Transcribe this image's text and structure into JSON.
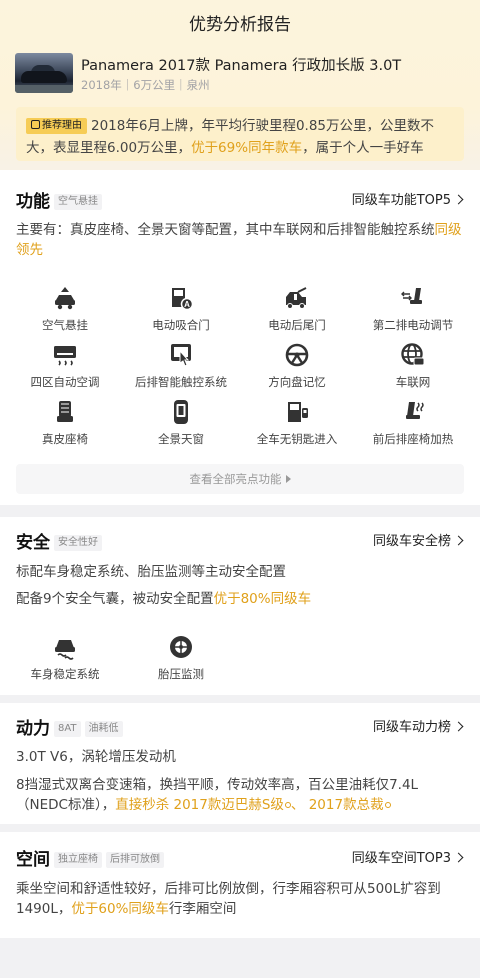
{
  "header": {
    "title": "优势分析报告"
  },
  "car": {
    "name": "Panamera 2017款 Panamera 行政加长版 3.0T",
    "meta": "2018年｜6万公里｜泉州"
  },
  "recommend": {
    "badge": "推荐理由",
    "text_before": "2018年6月上牌，年平均行驶里程0.85万公里，公里数不大，表显里程6.00万公里，",
    "text_highlight": "优于69%同年款车",
    "text_after": "，属于个人一手好车"
  },
  "function": {
    "title": "功能",
    "tag": "空气悬挂",
    "link": "同级车功能TOP5",
    "desc_before": "主要有：真皮座椅、全景天窗等配置，其中车联网和后排智能触控系统",
    "desc_highlight": "同级领先",
    "features": [
      {
        "label": "空气悬挂",
        "icon": "air-suspension-icon"
      },
      {
        "label": "电动吸合门",
        "icon": "soft-close-door-icon"
      },
      {
        "label": "电动后尾门",
        "icon": "power-tailgate-icon"
      },
      {
        "label": "第二排电动调节",
        "icon": "second-row-seat-icon"
      },
      {
        "label": "四区自动空调",
        "icon": "climate-icon"
      },
      {
        "label": "后排智能触控系统",
        "icon": "touch-control-icon"
      },
      {
        "label": "方向盘记忆",
        "icon": "steering-wheel-icon"
      },
      {
        "label": "车联网",
        "icon": "globe-icon"
      },
      {
        "label": "真皮座椅",
        "icon": "leather-seat-icon"
      },
      {
        "label": "全景天窗",
        "icon": "sunroof-icon"
      },
      {
        "label": "全车无钥匙进入",
        "icon": "keyless-door-icon"
      },
      {
        "label": "前后排座椅加热",
        "icon": "heated-seat-icon"
      }
    ],
    "more": "查看全部亮点功能"
  },
  "safety": {
    "title": "安全",
    "tag": "安全性好",
    "link": "同级车安全榜",
    "line1": "标配车身稳定系统、胎压监测等主动安全配置",
    "line2_before": "配备9个安全气囊，被动安全配置",
    "line2_highlight": "优于80%同级车",
    "features": [
      {
        "label": "车身稳定系统",
        "icon": "stability-icon"
      },
      {
        "label": "胎压监测",
        "icon": "tire-pressure-icon"
      }
    ]
  },
  "power": {
    "title": "动力",
    "tags": [
      "8AT",
      "油耗低"
    ],
    "link": "同级车动力榜",
    "line1": "3.0T V6，涡轮增压发动机",
    "line2": "8挡湿式双离合变速箱，换挡平顺，传动效率高，百公里油耗仅7.4L（NEDC标准），",
    "line2_highlight": "直接秒杀  2017款迈巴赫S级",
    "sep": "、",
    "line2_highlight2": "2017款总裁"
  },
  "space": {
    "title": "空间",
    "tags": [
      "独立座椅",
      "后排可放倒"
    ],
    "link": "同级车空间TOP3",
    "desc_before": "乘坐空间和舒适性较好，后排可比例放倒，行李厢容积可从500L扩容到1490L，",
    "desc_highlight": "优于60%同级车",
    "desc_after": "行李厢空间"
  }
}
